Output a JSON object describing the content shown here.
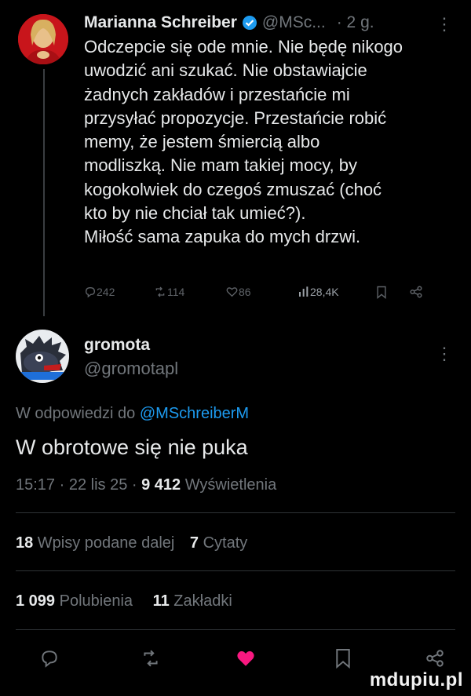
{
  "post1": {
    "author_name": "Marianna Schreiber",
    "handle": "@MSc...",
    "time": "· 2 g.",
    "more": "⋮",
    "body": "Odczepcie się ode mnie. Nie będę nikogo\nuwodzić ani szukać. Nie obstawiajcie\nżadnych zakładów i przestańcie mi\nprzysyłać propozycje. Przestańcie robić\nmemy, że jestem śmiercią albo\nmodliszką. Nie mam takiej mocy, by\nkogokolwiek do czegoś zmuszać (choć\nkto by nie chciał tak umieć?).\nMiłość sama zapuka do mych drzwi.",
    "replies": "242",
    "reposts": "114",
    "likes": "86",
    "views": "28,4K"
  },
  "post2": {
    "author_name": "gromota",
    "handle": "@gromotapl",
    "more": "⋮",
    "reply_prefix": "W odpowiedzi do ",
    "reply_mention": "@MSchreiberM",
    "body": "W obrotowe się nie puka",
    "time": "15:17 · 22 lis 25 · ",
    "views_count": "9 412",
    "views_label": " Wyświetlenia",
    "quotes_count": "18",
    "quotes_label": " Wpisy podane dalej",
    "citations_count": "7",
    "citations_label": " Cytaty",
    "likes_count": "1 099",
    "likes_label": " Polubienia",
    "bookmarks_count": "11",
    "bookmarks_label": " Zakładki"
  },
  "icons": {
    "reply": "reply-icon",
    "repost": "repost-icon",
    "like": "heart-icon",
    "bookmark": "bookmark-icon",
    "share": "share-icon",
    "views": "views-icon",
    "verified": "verified-badge-icon"
  },
  "colors": {
    "background": "#000000",
    "text": "#e7e9ea",
    "muted": "#71767b",
    "accent": "#1d9bf0",
    "like_active": "#f91880"
  },
  "watermark": "mdupiu.pl"
}
